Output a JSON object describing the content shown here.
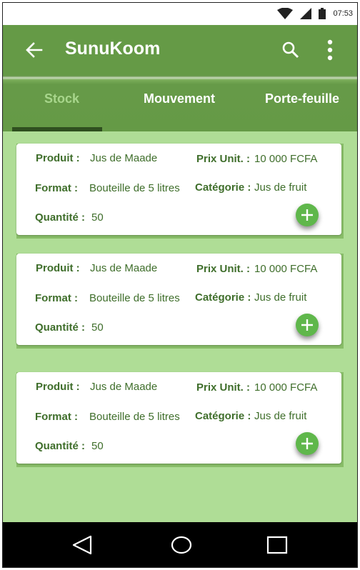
{
  "status_bar": {
    "time": "07:53",
    "icons": [
      "wifi-icon",
      "signal-icon",
      "battery-icon"
    ]
  },
  "app_bar": {
    "title": "SunuKoom",
    "icons": [
      "back-arrow-icon",
      "search-icon",
      "more-vert-icon"
    ]
  },
  "tabs": [
    {
      "label": "Stock",
      "active": true
    },
    {
      "label": "Mouvement",
      "active": false
    },
    {
      "label": "Porte-feuille",
      "active": false
    }
  ],
  "labels": {
    "produit": "Produit :",
    "prix": "Prix Unit. :",
    "format": "Format :",
    "categorie": "Catégorie :",
    "quantite": "Quantité :"
  },
  "products": [
    {
      "produit": "Jus de Maade",
      "prix": "10 000 FCFA",
      "format": "Bouteille de 5 litres",
      "categorie": "Jus de fruit",
      "quantite": "50"
    },
    {
      "produit": "Jus de Maade",
      "prix": "10 000 FCFA",
      "format": "Bouteille de 5 litres",
      "categorie": "Jus de fruit",
      "quantite": "50"
    },
    {
      "produit": "Jus de Maade",
      "prix": "10 000 FCFA",
      "format": "Bouteille de 5 litres",
      "categorie": "Jus de fruit",
      "quantite": "50"
    }
  ],
  "colors": {
    "primary": "#659a46",
    "active_tab": "#a8d68c",
    "indicator": "#2f4f1f",
    "content_bg": "#afdd96",
    "card_text": "#3f6e2b",
    "fab": "#5fb74b"
  },
  "nav_bar": {
    "icons": [
      "back-triangle-icon",
      "home-circle-icon",
      "recents-square-icon"
    ]
  }
}
